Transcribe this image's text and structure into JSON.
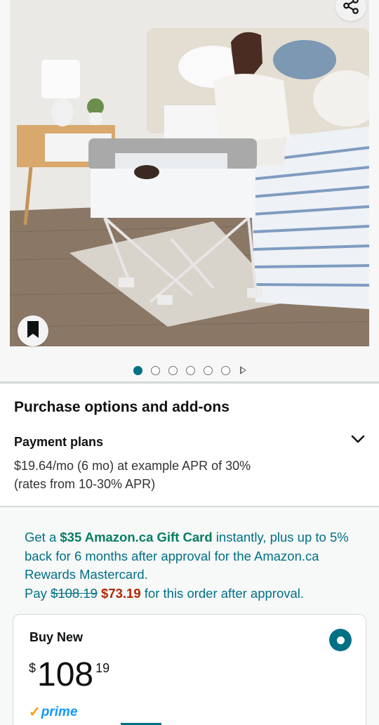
{
  "product_images": {
    "alt": "Portable bassinet next to bed",
    "dots_count": 6,
    "active_index": 0
  },
  "icons": {
    "share": "share-icon",
    "save": "bookmark-icon",
    "expand": "chevron-down-icon",
    "video": "play-icon"
  },
  "purchase": {
    "section_title": "Purchase options and add-ons",
    "payment_plans_title": "Payment plans",
    "payment_plans_line1": "$19.64/mo (6 mo) at example APR of 30%",
    "payment_plans_line2": "(rates from 10-30% APR)"
  },
  "promo": {
    "prefix": "Get a ",
    "gift": "$35 Amazon.ca Gift Card",
    "middle": " instantly, plus up to 5% back for 6 months after approval for the Amazon.ca Rewards Mastercard.",
    "pay_prefix": "Pay ",
    "old_price": "$108.19",
    "new_price": "$73.19",
    "suffix": " for this order after approval."
  },
  "buy_new": {
    "label": "Buy New",
    "currency": "$",
    "price_whole": "108",
    "price_fraction": "19",
    "prime_label": "prime",
    "selected": true
  },
  "colors": {
    "accent": "#007185",
    "gift": "#067d62",
    "deal": "#b12704",
    "prime": "#1399ff"
  }
}
